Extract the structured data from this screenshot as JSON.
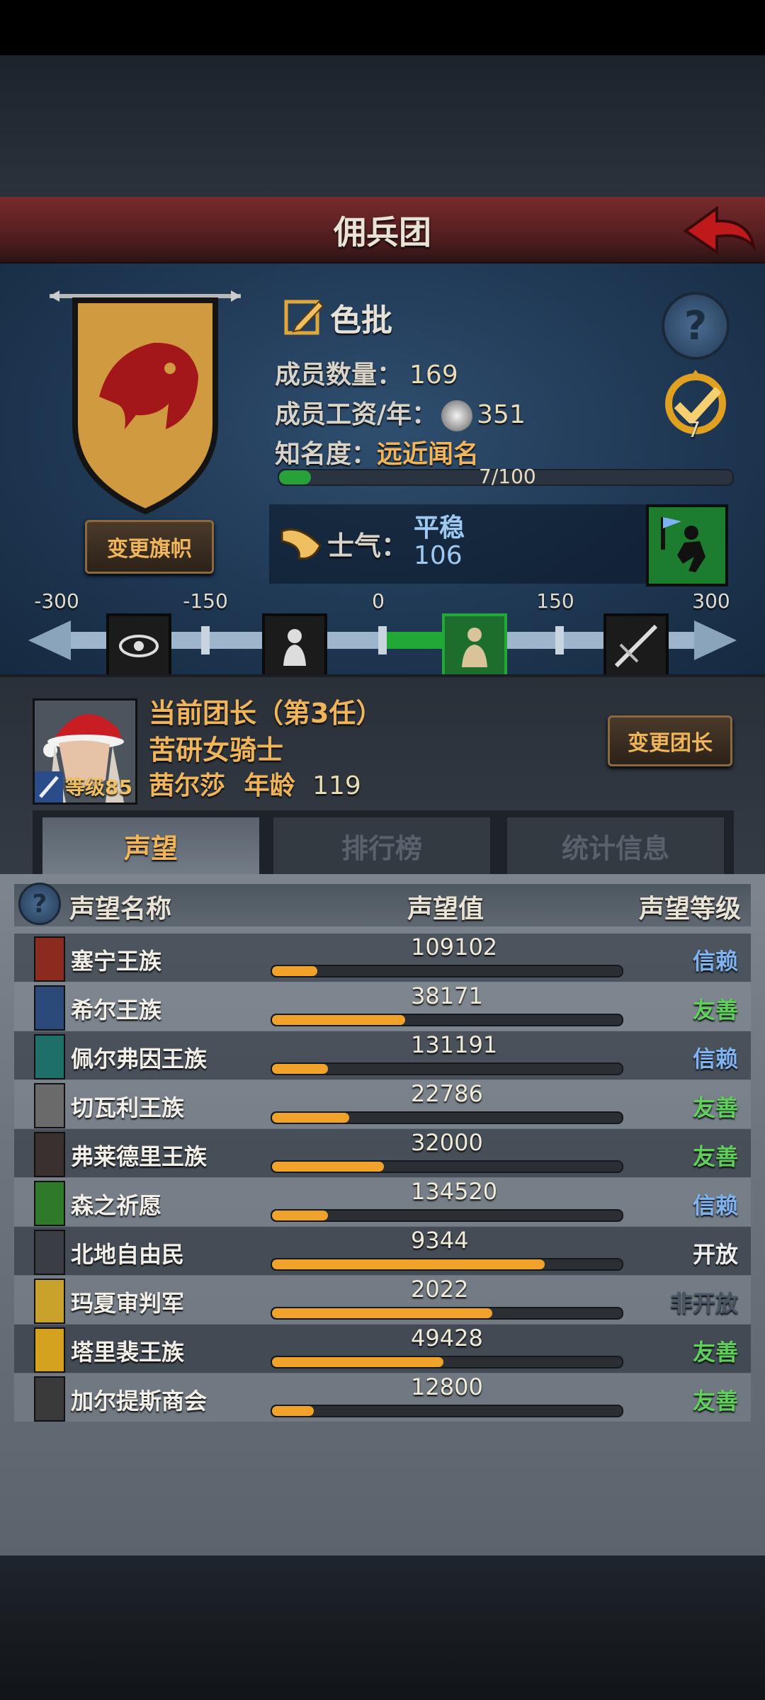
{
  "header": {
    "title": "佣兵团"
  },
  "guild": {
    "name": "色批",
    "members_label": "成员数量：",
    "members_value": "169",
    "wage_label": "成员工资/年：",
    "wage_value": "351",
    "fame_label": "知名度：",
    "fame_value": "远近闻名",
    "fame_progress_text": "7/100",
    "fame_progress": 0.07,
    "achievement_count": "7",
    "change_banner_label": "变更旗帜",
    "morale_label": "士气：",
    "morale_state": "平稳",
    "morale_value": "106"
  },
  "morale_scale": {
    "labels": [
      "-300",
      "-150",
      "0",
      "150",
      "300"
    ],
    "icons": [
      "eye-icon",
      "captive-icon",
      "praying-figure-icon",
      "sword-slash-icon"
    ]
  },
  "leader": {
    "title": "当前团长（第3任）",
    "class": "苦研女骑士",
    "name": "茜尔莎",
    "age_label": "年龄",
    "age": "119",
    "level": "等级85",
    "change_leader_label": "变更团长"
  },
  "tabs": [
    {
      "label": "声望",
      "active": true
    },
    {
      "label": "排行榜",
      "active": false
    },
    {
      "label": "统计信息",
      "active": false
    }
  ],
  "reputation": {
    "headers": {
      "name": "声望名称",
      "value": "声望值",
      "level": "声望等级"
    },
    "rows": [
      {
        "name": "塞宁王族",
        "value": "109102",
        "level": "信赖",
        "fill": 0.13,
        "badge": "#8b2a1e",
        "level_color": "#7fb2f0"
      },
      {
        "name": "希尔王族",
        "value": "38171",
        "level": "友善",
        "fill": 0.38,
        "badge": "#2b4a7a",
        "level_color": "#5fd05a"
      },
      {
        "name": "佩尔弗因王族",
        "value": "131191",
        "level": "信赖",
        "fill": 0.16,
        "badge": "#1e6e6a",
        "level_color": "#7fb2f0"
      },
      {
        "name": "切瓦利王族",
        "value": "22786",
        "level": "友善",
        "fill": 0.22,
        "badge": "#6a6a6a",
        "level_color": "#5fd05a"
      },
      {
        "name": "弗莱德里王族",
        "value": "32000",
        "level": "友善",
        "fill": 0.32,
        "badge": "#3a3030",
        "level_color": "#5fd05a"
      },
      {
        "name": "森之祈愿",
        "value": "134520",
        "level": "信赖",
        "fill": 0.16,
        "badge": "#2e7a2a",
        "level_color": "#7fb2f0"
      },
      {
        "name": "北地自由民",
        "value": "9344",
        "level": "开放",
        "fill": 0.78,
        "badge": "#3a3e44",
        "level_color": "#eeeeee"
      },
      {
        "name": "玛夏审判军",
        "value": "2022",
        "level": "非开放",
        "fill": 0.63,
        "badge": "#c8a22a",
        "level_color": "#4a5664"
      },
      {
        "name": "塔里裴王族",
        "value": "49428",
        "level": "友善",
        "fill": 0.49,
        "badge": "#d4a21e",
        "level_color": "#5fd05a"
      },
      {
        "name": "加尔提斯商会",
        "value": "12800",
        "level": "友善",
        "fill": 0.12,
        "badge": "#3a3a3a",
        "level_color": "#5fd05a"
      }
    ]
  }
}
